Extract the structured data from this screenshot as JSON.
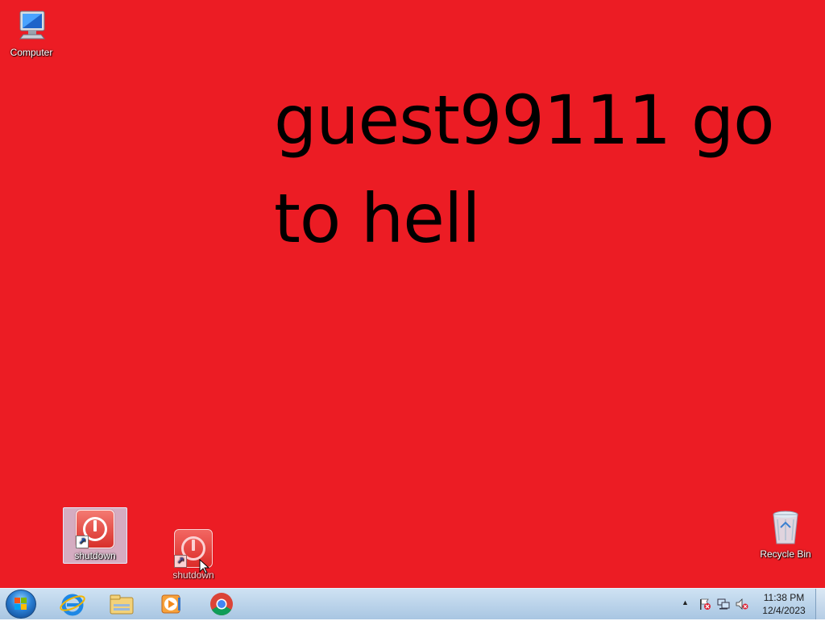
{
  "wallpaper": {
    "line1": "guest99111 go",
    "line2": "to hell",
    "background_color": "#ec1c24"
  },
  "desktop_icons": {
    "computer": {
      "label": "Computer",
      "icon": "computer-icon"
    },
    "shutdown_selected": {
      "label": "shutdown",
      "icon": "shutdown-shortcut-icon"
    },
    "shutdown_dragging": {
      "label": "shutdown",
      "icon": "shutdown-shortcut-icon"
    },
    "recycle_bin": {
      "label": "Recycle Bin",
      "icon": "recycle-bin-icon"
    }
  },
  "taskbar": {
    "pinned": [
      {
        "name": "Internet Explorer",
        "icon": "internet-explorer-icon"
      },
      {
        "name": "Windows Explorer",
        "icon": "folder-icon"
      },
      {
        "name": "Windows Media Player",
        "icon": "media-player-icon"
      },
      {
        "name": "Google Chrome",
        "icon": "chrome-icon"
      }
    ],
    "tray_icons": [
      "show-hidden-icons",
      "action-center-flag-icon",
      "network-icon",
      "volume-muted-icon"
    ],
    "clock": {
      "time": "11:38 PM",
      "date": "12/4/2023"
    }
  }
}
